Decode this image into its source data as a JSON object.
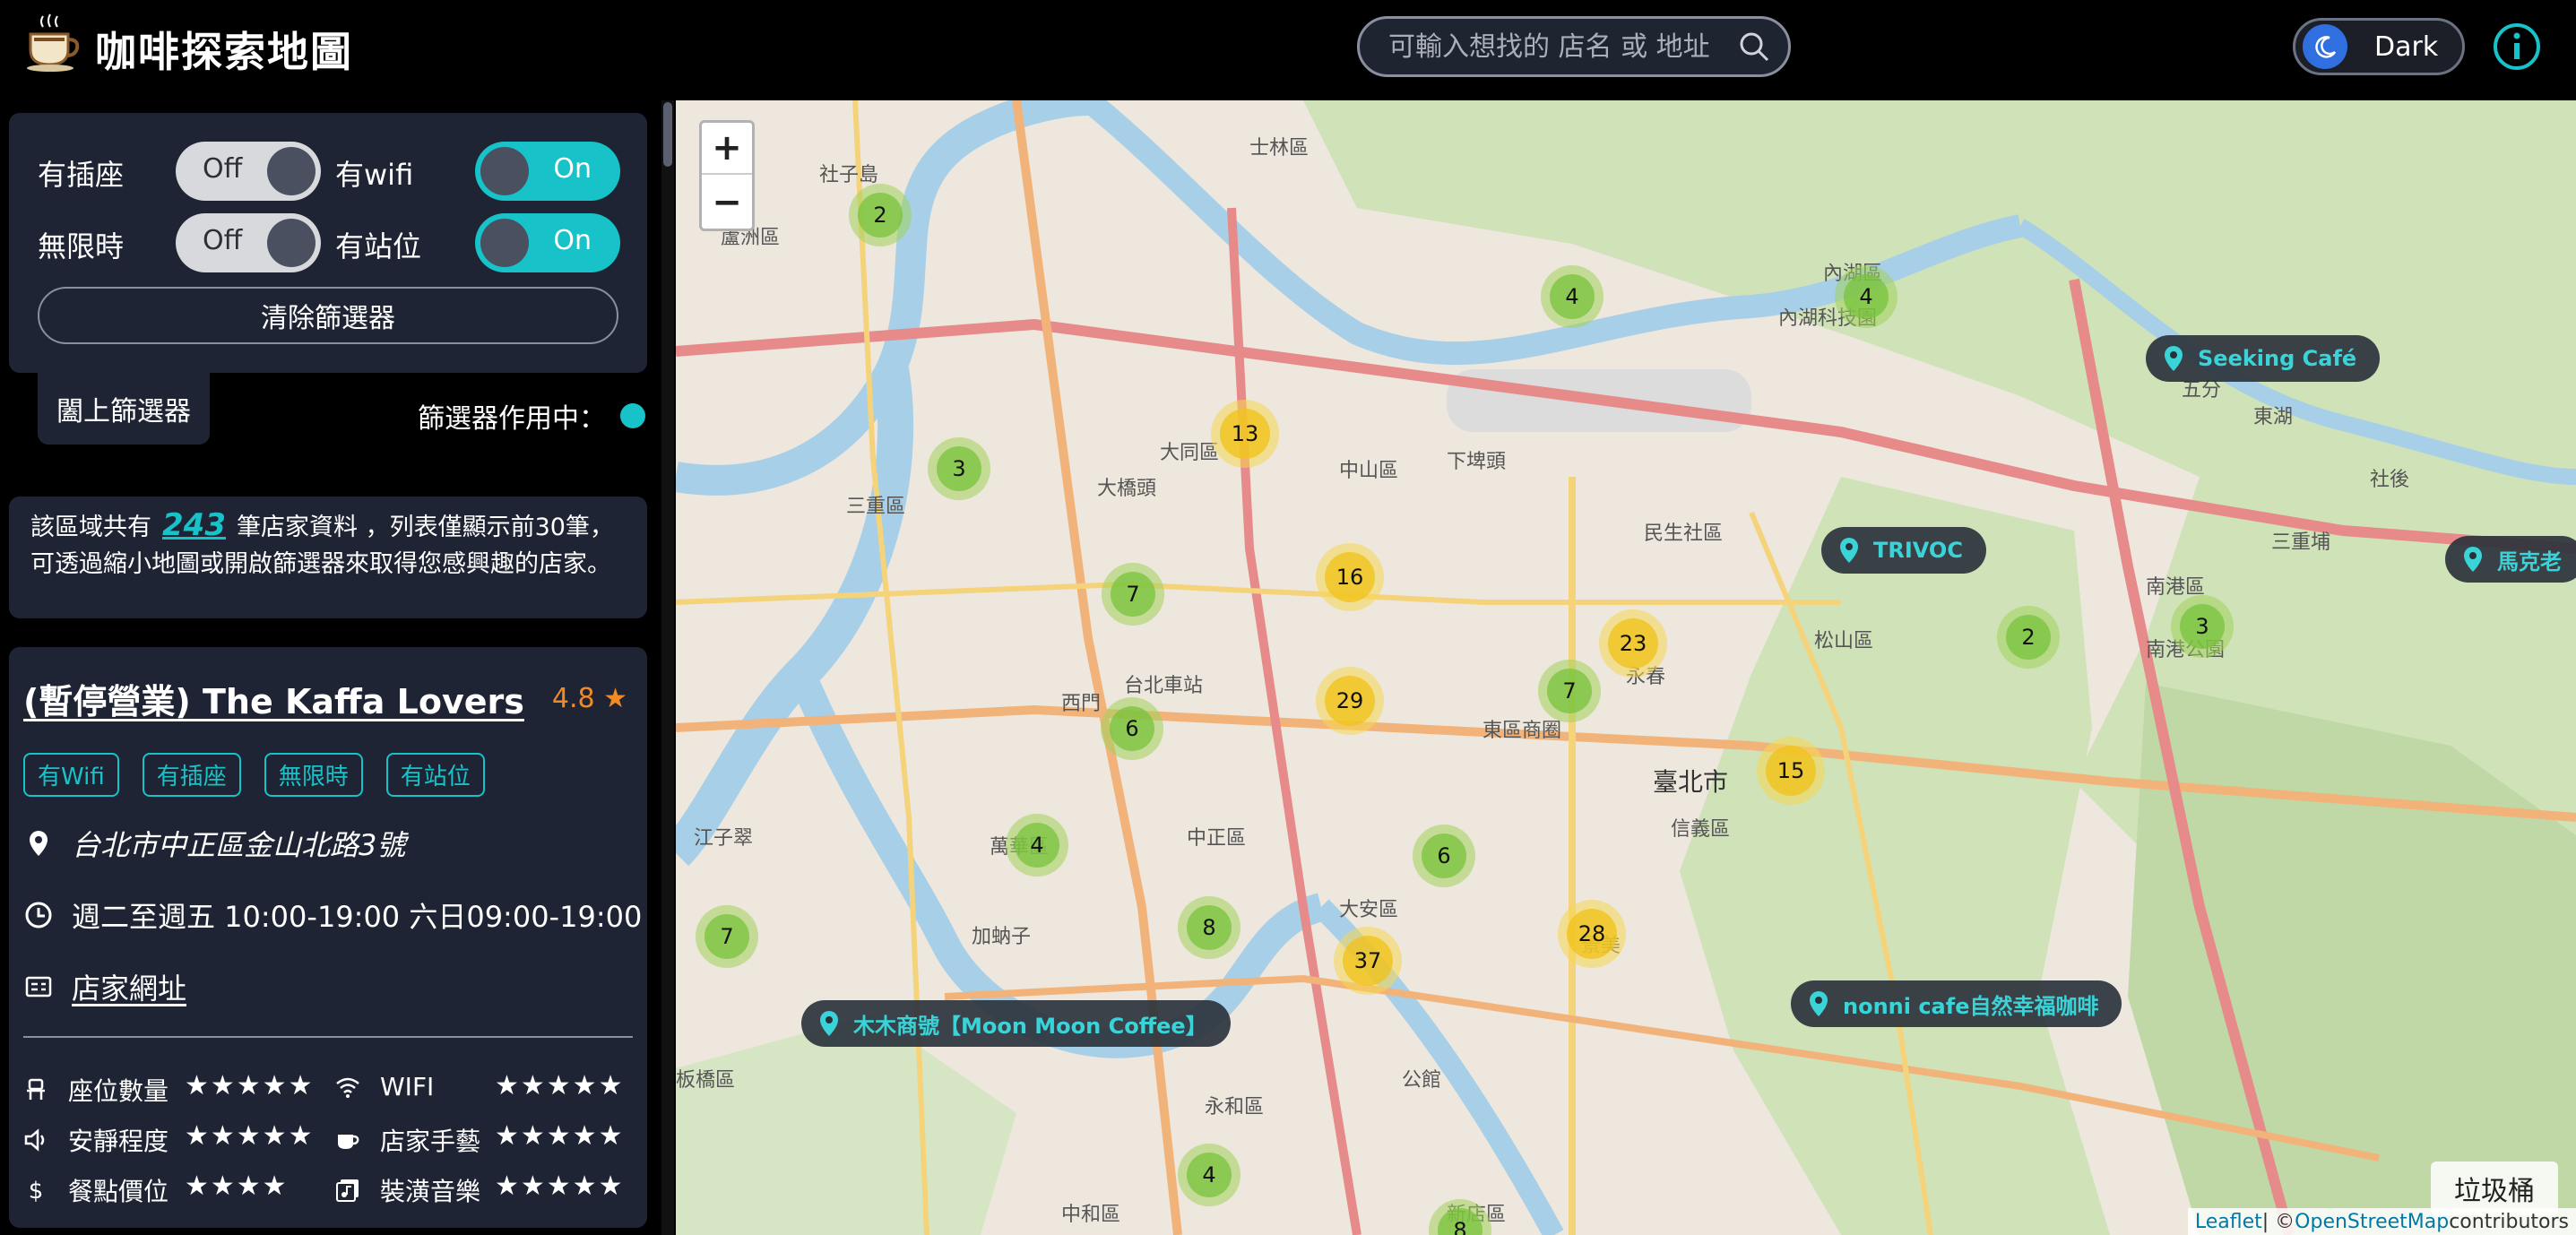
{
  "app": {
    "title": "咖啡探索地圖",
    "search_placeholder": "可輸入想找的 店名 或 地址",
    "theme_label": "Dark"
  },
  "filters": {
    "socket": {
      "label": "有插座",
      "state": "Off"
    },
    "wifi": {
      "label": "有wifi",
      "state": "On"
    },
    "no_limit": {
      "label": "無限時",
      "state": "Off"
    },
    "standing": {
      "label": "有站位",
      "state": "On"
    },
    "clear_label": "清除篩選器",
    "close_label": "闔上篩選器",
    "active_label": "篩選器作用中："
  },
  "summary": {
    "prefix": "該區域共有",
    "count": "243",
    "suffix": "筆店家資料 ，列表僅顯示前30筆，可透過縮小地圖或開啟篩選器來取得您感興趣的店家。"
  },
  "shop": {
    "name": "(暫停營業) The Kaffa Lovers",
    "rating": "4.8 ★",
    "tags": [
      "有Wifi",
      "有插座",
      "無限時",
      "有站位"
    ],
    "address": "台北市中正區金山北路3號",
    "hours": "週二至週五 10:00-19:00 六日09:00-19:00",
    "website_label": "店家網址",
    "stats": [
      {
        "label": "座位數量",
        "stars": "★★★★★",
        "icon": "seat-icon"
      },
      {
        "label": "WIFI",
        "stars": "★★★★★",
        "icon": "wifi-icon"
      },
      {
        "label": "安靜程度",
        "stars": "★★★★★",
        "icon": "volume-icon"
      },
      {
        "label": "店家手藝",
        "stars": "★★★★★",
        "icon": "coffee-cup-icon"
      },
      {
        "label": "餐點價位",
        "stars": "★★★★",
        "icon": "dollar-icon"
      },
      {
        "label": "裝潢音樂",
        "stars": "★★★★★",
        "icon": "music-icon"
      }
    ]
  },
  "map": {
    "zoom_in": "+",
    "zoom_out": "−",
    "clusters": [
      "2",
      "4",
      "4",
      "13",
      "3",
      "16",
      "7",
      "29",
      "23",
      "7",
      "6",
      "15",
      "4",
      "6",
      "2",
      "3",
      "8",
      "37",
      "28",
      "7",
      "4",
      "8"
    ],
    "places": [
      "Seeking Café",
      "TRIVOC",
      "馬克老",
      "nonni cafe自然幸福咖啡",
      "木木商號【Moon Moon Coffee】"
    ],
    "trash_label": "垃圾桶",
    "attribution": {
      "leaflet": "Leaflet",
      "sep": " | © ",
      "osm": "OpenStreetMap",
      "contrib": " contributors"
    },
    "labels": {
      "l1": "社子島",
      "l2": "士林區",
      "l3": "內湖科技園",
      "l4": "內湖區",
      "l5": "大同區",
      "l6": "中山區",
      "l7": "民生社區",
      "l8": "松山區",
      "l9": "南港區",
      "l10": "中正區",
      "l11": "萬華區",
      "l12": "大安區",
      "l13": "臺北市",
      "l14": "信義區",
      "l15": "三重區",
      "l16": "蘆洲區",
      "l17": "板橋區",
      "l18": "永和區",
      "l19": "中和區",
      "l20": "新店區",
      "l21": "東區商圈",
      "l22": "台北車站",
      "l23": "下埤頭",
      "l24": "五分",
      "l25": "東湖",
      "l26": "社後",
      "l27": "三重埔",
      "l28": "南港公園",
      "l29": "公館",
      "l30": "景美",
      "l31": "西門",
      "l32": "永春",
      "l33": "加蚋子",
      "l34": "江子翠",
      "l35": "大橋頭"
    }
  }
}
